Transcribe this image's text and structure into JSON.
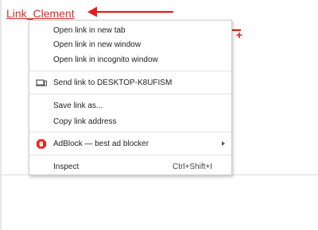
{
  "page": {
    "link_text": "Link_Clement"
  },
  "annotation": {
    "color": "#e8191c",
    "plus_glyph": "+"
  },
  "context_menu": {
    "open_new_tab": "Open link in new tab",
    "open_new_window": "Open link in new window",
    "open_incognito": "Open link in incognito window",
    "send_to_device": "Send link to DESKTOP-K8UFISM",
    "save_link_as": "Save link as...",
    "copy_link_address": "Copy link address",
    "adblock": "AdBlock — best ad blocker",
    "inspect": "Inspect",
    "inspect_shortcut": "Ctrl+Shift+I"
  },
  "icons": {
    "send_to_device": "device-icon",
    "adblock": "adblock-hand-icon",
    "adblock_color": "#e8291c",
    "submenu": "chevron-right-icon"
  }
}
